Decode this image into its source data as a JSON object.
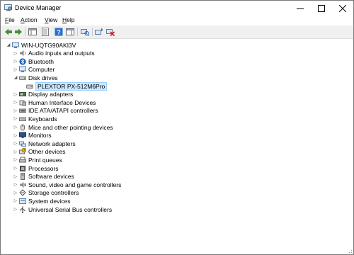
{
  "window": {
    "title": "Device Manager"
  },
  "menu": {
    "file": "File",
    "action": "Action",
    "view": "View",
    "help": "Help"
  },
  "tree": {
    "root": "WIN-UQTG90AKI3V",
    "categories": [
      {
        "label": "Audio inputs and outputs",
        "icon": "speaker-icon"
      },
      {
        "label": "Bluetooth",
        "icon": "bluetooth-icon"
      },
      {
        "label": "Computer",
        "icon": "computer-icon"
      },
      {
        "label": "Disk drives",
        "icon": "disk-drive-icon",
        "expanded": true,
        "children": [
          "PLEXTOR PX-512M6Pro"
        ]
      },
      {
        "label": "Display adapters",
        "icon": "display-adapter-icon"
      },
      {
        "label": "Human Interface Devices",
        "icon": "hid-icon"
      },
      {
        "label": "IDE ATA/ATAPI controllers",
        "icon": "ide-controller-icon"
      },
      {
        "label": "Keyboards",
        "icon": "keyboard-icon"
      },
      {
        "label": "Mice and other pointing devices",
        "icon": "mouse-icon"
      },
      {
        "label": "Monitors",
        "icon": "monitor-icon"
      },
      {
        "label": "Network adapters",
        "icon": "network-adapter-icon"
      },
      {
        "label": "Other devices",
        "icon": "other-devices-icon"
      },
      {
        "label": "Print queues",
        "icon": "printer-icon"
      },
      {
        "label": "Processors",
        "icon": "processor-icon"
      },
      {
        "label": "Software devices",
        "icon": "software-device-icon"
      },
      {
        "label": "Sound, video and game controllers",
        "icon": "sound-icon"
      },
      {
        "label": "Storage controllers",
        "icon": "storage-controller-icon"
      },
      {
        "label": "System devices",
        "icon": "system-devices-icon"
      },
      {
        "label": "Universal Serial Bus controllers",
        "icon": "usb-icon"
      }
    ]
  },
  "colors": {
    "selection_bg": "#cce8ff",
    "selection_border": "#99d1ff",
    "toolbar_bg": "#f0f0f0"
  }
}
